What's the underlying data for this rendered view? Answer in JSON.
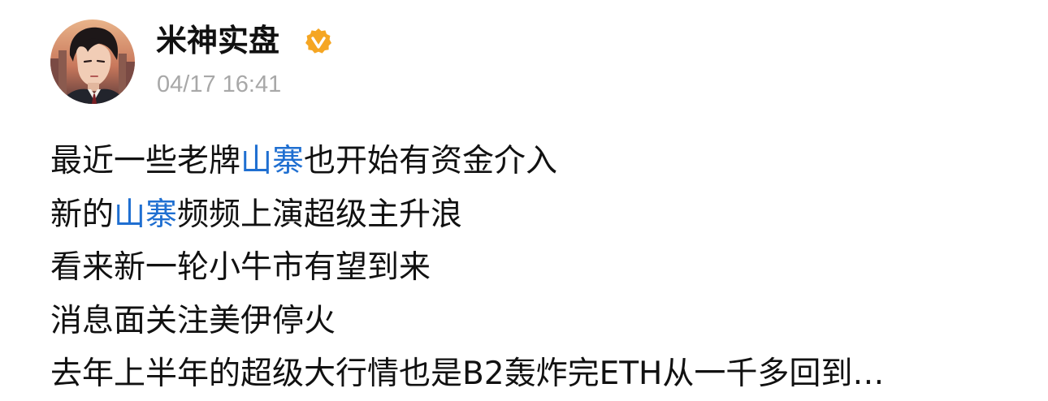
{
  "post": {
    "author": {
      "name": "米神实盘",
      "verified_color": "#f5a623"
    },
    "timestamp": "04/17 16:41",
    "accent_link_color": "#1f6fd1",
    "lines": [
      {
        "before": "最近一些老牌",
        "topic": "山寨",
        "after": "也开始有资金介入"
      },
      {
        "before": "新的",
        "topic": "山寨",
        "after": "频频上演超级主升浪"
      },
      {
        "text": "看来新一轮小牛市有望到来"
      },
      {
        "text": "消息面关注美伊停火"
      },
      {
        "text": "去年上半年的超级大行情也是B2轰炸完ETH从一千多回到…"
      }
    ]
  }
}
